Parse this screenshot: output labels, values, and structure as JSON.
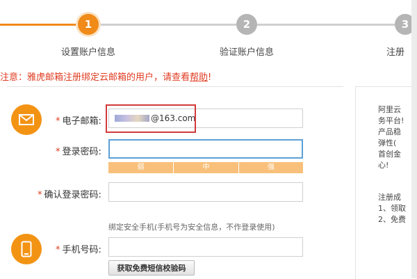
{
  "steps": [
    {
      "number": "1",
      "label": "设置账户信息",
      "state": "active"
    },
    {
      "number": "2",
      "label": "验证账户信息",
      "state": "inactive"
    },
    {
      "number": "3",
      "label": "注册",
      "state": "inactive"
    }
  ],
  "colors": {
    "accent": "#f08a18",
    "inactive": "#b5b5b5",
    "notice": "#e03c21",
    "focus": "#5c9fd6",
    "highlight": "#d23a3a"
  },
  "notice": {
    "text": "注意：雅虎邮箱注册绑定云邮箱的用户，请查看",
    "link": "帮助",
    "suffix": "!"
  },
  "form": {
    "email": {
      "label": "电子邮箱:",
      "value": "@163.com",
      "icon": "envelope-icon"
    },
    "password": {
      "label": "登录密码:",
      "value": ""
    },
    "strength": {
      "weak": "弱",
      "medium": "中",
      "strong": "强"
    },
    "confirm_password": {
      "label": "确认登录密码:",
      "value": ""
    },
    "phone_hint": "绑定安全手机(手机号为安全信息，不作登录使用)",
    "phone": {
      "label": "手机号码:",
      "value": "",
      "icon": "mobile-phone-icon"
    },
    "sms_button": "获取免费短信校验码"
  },
  "sidebar": {
    "lines": [
      "阿里云",
      "务平台!",
      "产品稳",
      "弹性(",
      "首创金",
      "心!"
    ],
    "register_title": "注册成",
    "items": [
      "1、领取",
      "2、免费"
    ]
  }
}
